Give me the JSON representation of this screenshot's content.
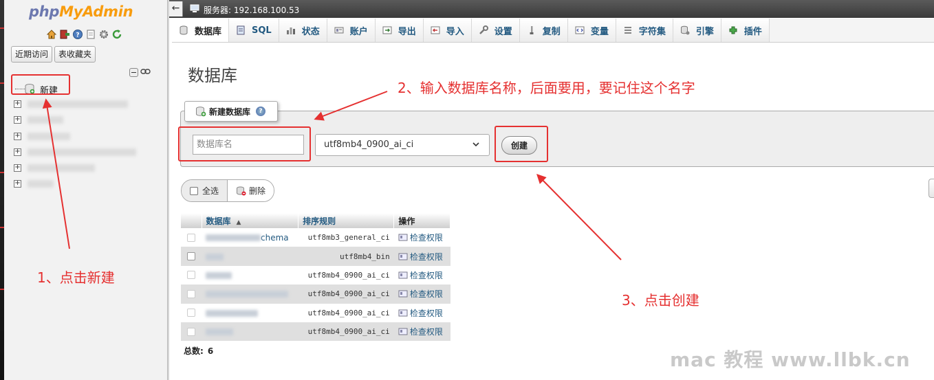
{
  "app": {
    "logo_php": "php",
    "logo_myadmin": "MyAdmin",
    "server_label": "服务器:  192.168.100.53"
  },
  "sidebar": {
    "tabs": [
      "近期访问",
      "表收藏夹"
    ],
    "new_label": "新建",
    "quick_icons": [
      "home-icon",
      "exit-icon",
      "help-icon",
      "docs-icon",
      "settings-icon",
      "reload-icon"
    ]
  },
  "tabs": [
    {
      "label": "数据库",
      "icon": "database-icon",
      "active": true
    },
    {
      "label": "SQL",
      "icon": "sql-icon"
    },
    {
      "label": "状态",
      "icon": "status-icon"
    },
    {
      "label": "账户",
      "icon": "accounts-icon"
    },
    {
      "label": "导出",
      "icon": "export-icon"
    },
    {
      "label": "导入",
      "icon": "import-icon"
    },
    {
      "label": "设置",
      "icon": "wrench-icon"
    },
    {
      "label": "复制",
      "icon": "replication-icon"
    },
    {
      "label": "变量",
      "icon": "variables-icon"
    },
    {
      "label": "字符集",
      "icon": "charset-icon"
    },
    {
      "label": "引擎",
      "icon": "engine-icon"
    },
    {
      "label": "插件",
      "icon": "plugin-icon"
    }
  ],
  "main": {
    "title": "数据库",
    "create_legend": "新建数据库",
    "db_name_placeholder": "数据库名",
    "collation_selected": "utf8mb4_0900_ai_ci",
    "create_button": "创建",
    "select_all": "全选",
    "delete": "删除",
    "table_headers": {
      "name": "数据库",
      "collation": "排序规则",
      "action": "操作"
    },
    "rows": [
      {
        "name": "chema",
        "collation": "utf8mb3_general_ci",
        "action": "检查权限"
      },
      {
        "name": "",
        "collation": "utf8mb4_bin",
        "action": "检查权限"
      },
      {
        "name": "",
        "collation": "utf8mb4_0900_ai_ci",
        "action": "检查权限"
      },
      {
        "name": "",
        "collation": "utf8mb4_0900_ai_ci",
        "action": "检查权限"
      },
      {
        "name": "",
        "collation": "utf8mb4_0900_ai_ci",
        "action": "检查权限"
      },
      {
        "name": "",
        "collation": "utf8mb4_0900_ai_ci",
        "action": "检查权限"
      }
    ],
    "total_label": "总数:",
    "total_value": "6"
  },
  "annotations": {
    "step1": "1、点击新建",
    "step2": "2、输入数据库名称，后面要用，要记住这个名字",
    "step3": "3、点击创建",
    "color": "#e53030"
  },
  "watermark": "mac 教程 www.llbk.cn"
}
